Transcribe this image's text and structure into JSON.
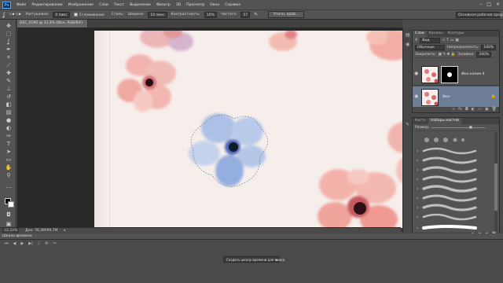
{
  "menubar": {
    "logo": "Ps",
    "items": [
      "Файл",
      "Редактирование",
      "Изображение",
      "Слои",
      "Текст",
      "Выделение",
      "Фильтр",
      "3D",
      "Просмотр",
      "Окно",
      "Справка"
    ]
  },
  "options": {
    "feather_label": "Растушевка:",
    "feather_value": "0 пикс",
    "antialias_label": "Сглаживание",
    "style_label": "Стиль:",
    "width_label": "Ширина:",
    "width_value": "10 пикс",
    "contrast_label": "Контрастность:",
    "contrast_value": "10%",
    "freq_label": "Частота:",
    "freq_value": "57",
    "refine_button": "Уточн. край...",
    "workspace": "Основная рабочая среда"
  },
  "document": {
    "tab_title": "DSC_0190 @ 33,3% (Фон, RGB/8#)"
  },
  "status": {
    "zoom": "33,33%",
    "doc_size": "Док: 76,3М/99,7М"
  },
  "timeline": {
    "tab_label": "Шкала времени",
    "create_button": "Создать шкалу времени для видео"
  },
  "layers_panel": {
    "tabs": [
      "Слои",
      "Каналы",
      "Контуры"
    ],
    "kind_label": "Вид",
    "blend_mode": "Обычные",
    "opacity_label": "Непрозрачность:",
    "opacity_value": "100%",
    "lock_label": "Закрепить:",
    "fill_label": "Заливка:",
    "fill_value": "100%",
    "layers": [
      {
        "name": "Фон копия 4"
      },
      {
        "name": "Фон"
      }
    ]
  },
  "brush_panel": {
    "tabs": [
      "Кисть",
      "Наборы кистей"
    ],
    "size_label": "Размер:"
  },
  "colors": {
    "accent": "#6e7d96",
    "panel": "#535353",
    "canvas_bg": "#282828"
  }
}
